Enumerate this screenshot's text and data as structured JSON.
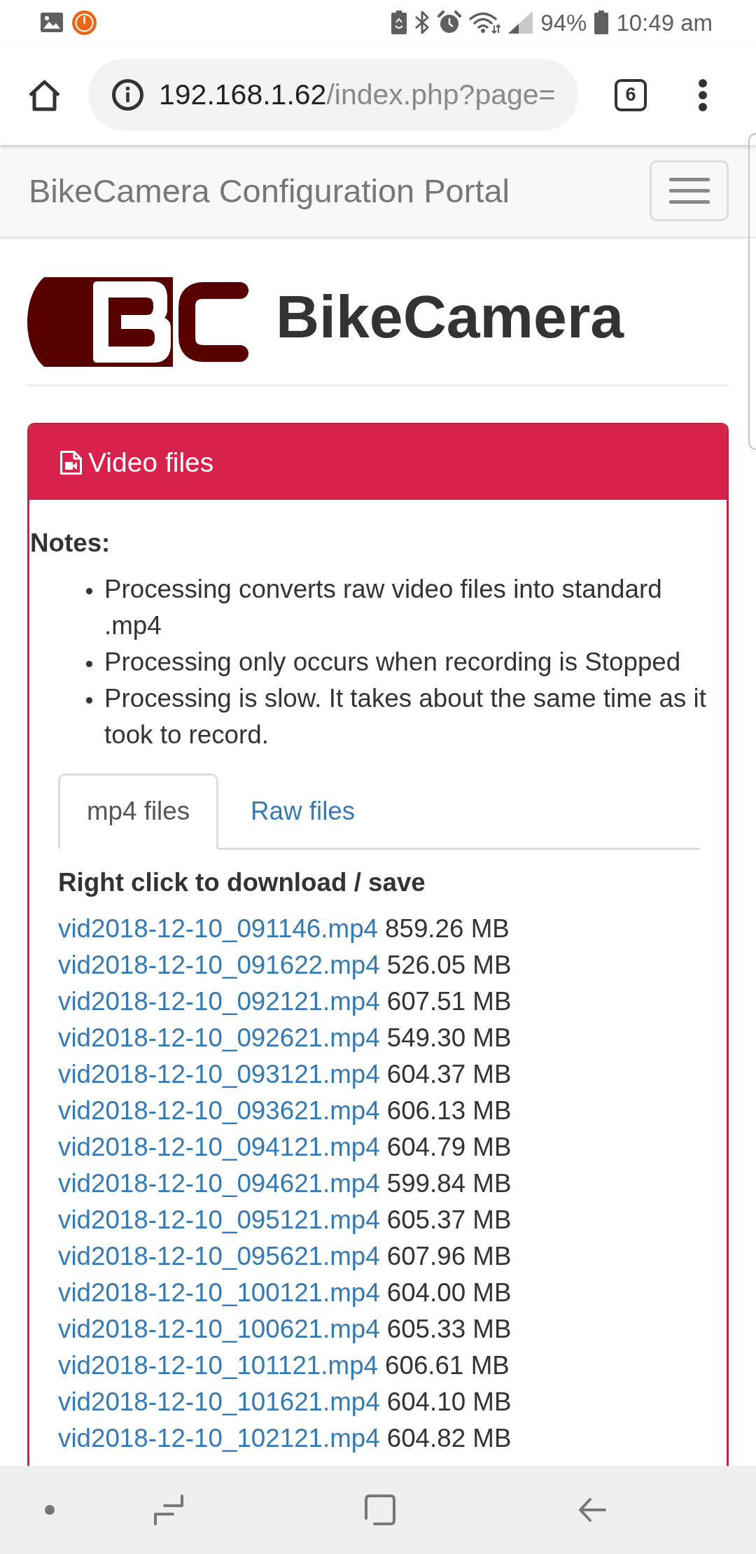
{
  "status_bar": {
    "battery": "94%",
    "time": "10:49 am"
  },
  "browser": {
    "url_host": "192.168.1.62",
    "url_path": "/index.php?page=",
    "tab_count": "6"
  },
  "navbar": {
    "brand": "BikeCamera Configuration Portal"
  },
  "page_header": {
    "title": "BikeCamera"
  },
  "panel": {
    "title": "Video files",
    "notes_label": "Notes:",
    "notes": [
      "Processing converts raw video files into standard .mp4",
      "Processing only occurs when recording is Stopped",
      "Processing is slow. It takes about the same time as it took to record."
    ],
    "tabs": [
      {
        "label": "mp4 files",
        "selected": true
      },
      {
        "label": "Raw files",
        "selected": false
      }
    ],
    "hint": "Right click to download / save",
    "files": [
      {
        "name": "vid2018-12-10_091146.mp4",
        "size": "859.26 MB"
      },
      {
        "name": "vid2018-12-10_091622.mp4",
        "size": "526.05 MB"
      },
      {
        "name": "vid2018-12-10_092121.mp4",
        "size": "607.51 MB"
      },
      {
        "name": "vid2018-12-10_092621.mp4",
        "size": "549.30 MB"
      },
      {
        "name": "vid2018-12-10_093121.mp4",
        "size": "604.37 MB"
      },
      {
        "name": "vid2018-12-10_093621.mp4",
        "size": "606.13 MB"
      },
      {
        "name": "vid2018-12-10_094121.mp4",
        "size": "604.79 MB"
      },
      {
        "name": "vid2018-12-10_094621.mp4",
        "size": "599.84 MB"
      },
      {
        "name": "vid2018-12-10_095121.mp4",
        "size": "605.37 MB"
      },
      {
        "name": "vid2018-12-10_095621.mp4",
        "size": "607.96 MB"
      },
      {
        "name": "vid2018-12-10_100121.mp4",
        "size": "604.00 MB"
      },
      {
        "name": "vid2018-12-10_100621.mp4",
        "size": "605.33 MB"
      },
      {
        "name": "vid2018-12-10_101121.mp4",
        "size": "606.61 MB"
      },
      {
        "name": "vid2018-12-10_101621.mp4",
        "size": "604.10 MB"
      },
      {
        "name": "vid2018-12-10_102121.mp4",
        "size": "604.82 MB"
      }
    ]
  }
}
